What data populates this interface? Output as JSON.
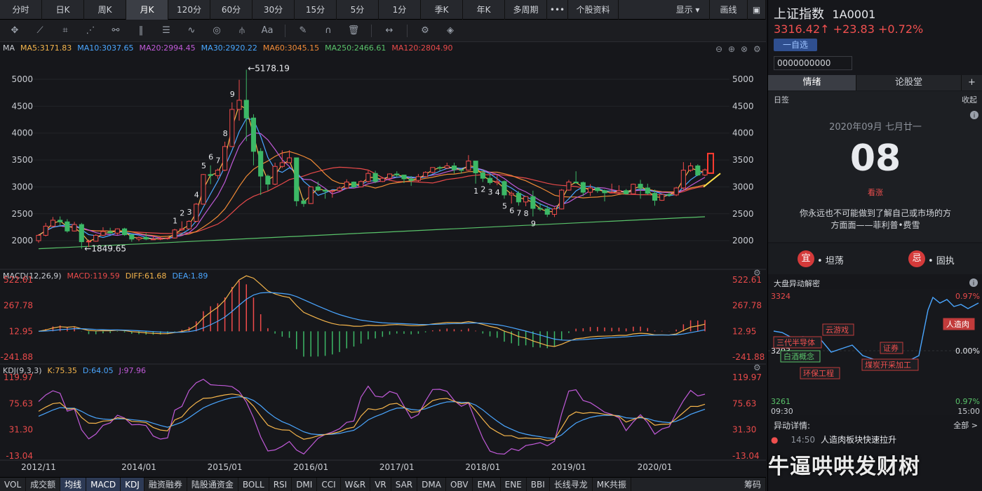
{
  "topbar": {
    "periods": [
      {
        "label": "分时",
        "active": false,
        "w": 60
      },
      {
        "label": "日K",
        "active": false,
        "w": 60
      },
      {
        "label": "周K",
        "active": false,
        "w": 60
      },
      {
        "label": "月K",
        "active": true,
        "w": 60
      },
      {
        "label": "120分",
        "active": false,
        "w": 60
      },
      {
        "label": "60分",
        "active": false,
        "w": 60
      },
      {
        "label": "30分",
        "active": false,
        "w": 60
      },
      {
        "label": "15分",
        "active": false,
        "w": 60
      },
      {
        "label": "5分",
        "active": false,
        "w": 60
      },
      {
        "label": "1分",
        "active": false,
        "w": 60
      },
      {
        "label": "季K",
        "active": false,
        "w": 60
      },
      {
        "label": "年K",
        "active": false,
        "w": 60
      },
      {
        "label": "多周期",
        "active": false,
        "w": 60
      },
      {
        "label": "•••",
        "active": false,
        "w": 30
      },
      {
        "label": "个股资料",
        "active": false,
        "w": 72
      }
    ],
    "display_label": "显示",
    "draw_label": "画线"
  },
  "ma_line": [
    {
      "text": "MA",
      "color": "#c9ccd2"
    },
    {
      "text": "MA5:3171.83",
      "color": "#f5b54b"
    },
    {
      "text": "MA10:3037.65",
      "color": "#4aa6ff"
    },
    {
      "text": "MA20:2994.45",
      "color": "#c05ad8"
    },
    {
      "text": "MA30:2920.22",
      "color": "#48a7ff"
    },
    {
      "text": "MA60:3045.15",
      "color": "#f08a36"
    },
    {
      "text": "MA250:2466.61",
      "color": "#59c36a"
    },
    {
      "text": "MA120:2804.90",
      "color": "#e94a4a"
    }
  ],
  "macd_line": [
    {
      "text": "MACD(12,26,9)",
      "color": "#c9ccd2"
    },
    {
      "text": "MACD:119.59",
      "color": "#e94a4a"
    },
    {
      "text": "DIFF:61.68",
      "color": "#f5b54b"
    },
    {
      "text": "DEA:1.89",
      "color": "#4aa6ff"
    }
  ],
  "kdj_line": [
    {
      "text": "KDJ(9,3,3)",
      "color": "#c9ccd2"
    },
    {
      "text": "K:75.35",
      "color": "#f5b54b"
    },
    {
      "text": "D:64.05",
      "color": "#4aa6ff"
    },
    {
      "text": "J:97.96",
      "color": "#c05ad8"
    }
  ],
  "chart_data": {
    "type": "candlestick",
    "price_ticks": [
      "5000",
      "4500",
      "4000",
      "3500",
      "3000",
      "2500",
      "2000"
    ],
    "macd_ticks": [
      "522.61",
      "267.78",
      "12.95",
      "-241.88"
    ],
    "kdj_ticks": [
      "119.97",
      "75.63",
      "31.30",
      "-13.04"
    ],
    "x_ticks": [
      "2012/11",
      "2014/01",
      "2015/01",
      "2016/01",
      "2017/01",
      "2018/01",
      "2019/01",
      "2020/01"
    ],
    "annotations": {
      "high": "←5178.19",
      "low": "←1849.65"
    },
    "td_up_labels": [
      "1",
      "2",
      "3",
      "4",
      "5",
      "6",
      "7",
      "8",
      "9"
    ],
    "td_down_labels": [
      "1",
      "2",
      "3",
      "4",
      "5",
      "6",
      "7",
      "8",
      "9"
    ],
    "monthly": [
      {
        "o": 2000,
        "h": 2120,
        "l": 1960,
        "c": 2100
      },
      {
        "o": 2100,
        "h": 2330,
        "l": 2080,
        "c": 2270
      },
      {
        "o": 2270,
        "h": 2440,
        "l": 2250,
        "c": 2380
      },
      {
        "o": 2380,
        "h": 2450,
        "l": 2280,
        "c": 2350
      },
      {
        "o": 2350,
        "h": 2400,
        "l": 2150,
        "c": 2180
      },
      {
        "o": 2180,
        "h": 2350,
        "l": 2170,
        "c": 2300
      },
      {
        "o": 2300,
        "h": 2330,
        "l": 1850,
        "c": 1980
      },
      {
        "o": 1980,
        "h": 2020,
        "l": 1880,
        "c": 1990
      },
      {
        "o": 1990,
        "h": 2120,
        "l": 1980,
        "c": 2100
      },
      {
        "o": 2100,
        "h": 2250,
        "l": 2090,
        "c": 2170
      },
      {
        "o": 2170,
        "h": 2240,
        "l": 2130,
        "c": 2140
      },
      {
        "o": 2140,
        "h": 2230,
        "l": 2110,
        "c": 2220
      },
      {
        "o": 2220,
        "h": 2240,
        "l": 2090,
        "c": 2110
      },
      {
        "o": 2110,
        "h": 2120,
        "l": 1980,
        "c": 2030
      },
      {
        "o": 2030,
        "h": 2080,
        "l": 1990,
        "c": 2060
      },
      {
        "o": 2060,
        "h": 2140,
        "l": 2010,
        "c": 2030
      },
      {
        "o": 2030,
        "h": 2100,
        "l": 2020,
        "c": 2030
      },
      {
        "o": 2030,
        "h": 2080,
        "l": 2010,
        "c": 2040
      },
      {
        "o": 2040,
        "h": 2060,
        "l": 2020,
        "c": 2050
      },
      {
        "o": 2050,
        "h": 2220,
        "l": 2040,
        "c": 2200
      },
      {
        "o": 2200,
        "h": 2360,
        "l": 2180,
        "c": 2220
      },
      {
        "o": 2220,
        "h": 2380,
        "l": 2210,
        "c": 2360
      },
      {
        "o": 2360,
        "h": 2700,
        "l": 2340,
        "c": 2680
      },
      {
        "o": 2680,
        "h": 3240,
        "l": 2670,
        "c": 3230
      },
      {
        "o": 3230,
        "h": 3400,
        "l": 3050,
        "c": 3210
      },
      {
        "o": 3210,
        "h": 3340,
        "l": 3150,
        "c": 3310
      },
      {
        "o": 3310,
        "h": 3840,
        "l": 3290,
        "c": 3750
      },
      {
        "o": 3750,
        "h": 4570,
        "l": 3740,
        "c": 4440
      },
      {
        "o": 4440,
        "h": 4990,
        "l": 4230,
        "c": 4610
      },
      {
        "o": 4610,
        "h": 5178,
        "l": 3850,
        "c": 4280
      },
      {
        "o": 4280,
        "h": 4350,
        "l": 3400,
        "c": 3660
      },
      {
        "o": 3660,
        "h": 3720,
        "l": 2850,
        "c": 3200
      },
      {
        "o": 3200,
        "h": 3230,
        "l": 2930,
        "c": 3050
      },
      {
        "o": 3050,
        "h": 3450,
        "l": 3030,
        "c": 3380
      },
      {
        "o": 3380,
        "h": 3680,
        "l": 3350,
        "c": 3450
      },
      {
        "o": 3450,
        "h": 3680,
        "l": 3450,
        "c": 3540
      },
      {
        "o": 3540,
        "h": 3540,
        "l": 2640,
        "c": 2740
      },
      {
        "o": 2740,
        "h": 2790,
        "l": 2630,
        "c": 2690
      },
      {
        "o": 2690,
        "h": 3010,
        "l": 2680,
        "c": 3000
      },
      {
        "o": 3000,
        "h": 3100,
        "l": 2920,
        "c": 2940
      },
      {
        "o": 2940,
        "h": 2960,
        "l": 2780,
        "c": 2920
      },
      {
        "o": 2920,
        "h": 2950,
        "l": 2800,
        "c": 2930
      },
      {
        "o": 2930,
        "h": 3010,
        "l": 2920,
        "c": 2980
      },
      {
        "o": 2980,
        "h": 3140,
        "l": 2960,
        "c": 3090
      },
      {
        "o": 3090,
        "h": 3100,
        "l": 2980,
        "c": 3000
      },
      {
        "o": 3000,
        "h": 3120,
        "l": 2990,
        "c": 3100
      },
      {
        "o": 3100,
        "h": 3300,
        "l": 3080,
        "c": 3250
      },
      {
        "o": 3250,
        "h": 3300,
        "l": 3070,
        "c": 3100
      },
      {
        "o": 3100,
        "h": 3180,
        "l": 3090,
        "c": 3160
      },
      {
        "o": 3160,
        "h": 3250,
        "l": 3150,
        "c": 3240
      },
      {
        "o": 3240,
        "h": 3290,
        "l": 3180,
        "c": 3220
      },
      {
        "o": 3220,
        "h": 3220,
        "l": 3070,
        "c": 3150
      },
      {
        "o": 3150,
        "h": 3200,
        "l": 3020,
        "c": 3120
      },
      {
        "o": 3120,
        "h": 3240,
        "l": 3090,
        "c": 3190
      },
      {
        "o": 3190,
        "h": 3290,
        "l": 3180,
        "c": 3270
      },
      {
        "o": 3270,
        "h": 3360,
        "l": 3250,
        "c": 3360
      },
      {
        "o": 3360,
        "h": 3390,
        "l": 3300,
        "c": 3350
      },
      {
        "o": 3350,
        "h": 3450,
        "l": 3330,
        "c": 3390
      },
      {
        "o": 3390,
        "h": 3450,
        "l": 3250,
        "c": 3320
      },
      {
        "o": 3320,
        "h": 3320,
        "l": 3250,
        "c": 3310
      },
      {
        "o": 3310,
        "h": 3590,
        "l": 3300,
        "c": 3480
      },
      {
        "o": 3480,
        "h": 3480,
        "l": 3060,
        "c": 3260
      },
      {
        "o": 3260,
        "h": 3330,
        "l": 3090,
        "c": 3160
      },
      {
        "o": 3160,
        "h": 3220,
        "l": 3040,
        "c": 3080
      },
      {
        "o": 3080,
        "h": 3220,
        "l": 3030,
        "c": 3100
      },
      {
        "o": 3100,
        "h": 3120,
        "l": 2780,
        "c": 2850
      },
      {
        "o": 2850,
        "h": 2920,
        "l": 2690,
        "c": 2880
      },
      {
        "o": 2880,
        "h": 2920,
        "l": 2650,
        "c": 2720
      },
      {
        "o": 2720,
        "h": 2830,
        "l": 2640,
        "c": 2820
      },
      {
        "o": 2820,
        "h": 2930,
        "l": 2450,
        "c": 2600
      },
      {
        "o": 2600,
        "h": 2700,
        "l": 2550,
        "c": 2590
      },
      {
        "o": 2590,
        "h": 2650,
        "l": 2440,
        "c": 2490
      },
      {
        "o": 2490,
        "h": 2620,
        "l": 2440,
        "c": 2590
      },
      {
        "o": 2590,
        "h": 2960,
        "l": 2580,
        "c": 2940
      },
      {
        "o": 2940,
        "h": 3130,
        "l": 2930,
        "c": 3090
      },
      {
        "o": 3090,
        "h": 3290,
        "l": 3060,
        "c": 3080
      },
      {
        "o": 3080,
        "h": 3100,
        "l": 2830,
        "c": 2900
      },
      {
        "o": 2900,
        "h": 3050,
        "l": 2830,
        "c": 2980
      },
      {
        "o": 2980,
        "h": 2990,
        "l": 2890,
        "c": 2930
      },
      {
        "o": 2930,
        "h": 2950,
        "l": 2730,
        "c": 2890
      },
      {
        "o": 2890,
        "h": 3060,
        "l": 2880,
        "c": 2900
      },
      {
        "o": 2900,
        "h": 3030,
        "l": 2880,
        "c": 2930
      },
      {
        "o": 2930,
        "h": 2960,
        "l": 2860,
        "c": 2870
      },
      {
        "o": 2870,
        "h": 3060,
        "l": 2860,
        "c": 3050
      },
      {
        "o": 3050,
        "h": 3130,
        "l": 2780,
        "c": 2980
      },
      {
        "o": 2980,
        "h": 3060,
        "l": 2850,
        "c": 2880
      },
      {
        "o": 2880,
        "h": 2950,
        "l": 2650,
        "c": 2750
      },
      {
        "o": 2750,
        "h": 2860,
        "l": 2740,
        "c": 2860
      },
      {
        "o": 2860,
        "h": 2900,
        "l": 2820,
        "c": 2850
      },
      {
        "o": 2850,
        "h": 3000,
        "l": 2830,
        "c": 2980
      },
      {
        "o": 2980,
        "h": 3460,
        "l": 2950,
        "c": 3310
      },
      {
        "o": 3310,
        "h": 3450,
        "l": 3280,
        "c": 3390
      },
      {
        "o": 3390,
        "h": 3420,
        "l": 3200,
        "c": 3220
      },
      {
        "o": 3220,
        "h": 3340,
        "l": 3200,
        "c": 3316
      }
    ],
    "ylim_price": [
      1780,
      5300
    ]
  },
  "right": {
    "name": "上证指数",
    "code": "1A0001",
    "price": "3316.42",
    "arrow": "↑",
    "change": "+23.83",
    "pct": "+0.72%",
    "add_watch": "一自选",
    "input_value": "0000000000",
    "tab_qingxu": "情绪",
    "tab_lungutang": "论股堂",
    "tab_add": "+",
    "rixian": "日签",
    "shouqi": "收起",
    "date": "2020年09月 七月廿一",
    "day": "08",
    "mood": "看涨",
    "quote": "你永远也不可能做到了解自己或市场的方方面面——菲利普•费雪",
    "yi": "宜",
    "yi_text": "• 坦荡",
    "ji": "忌",
    "ji_text": "• 固执",
    "dapan_title": "大盘异动解密",
    "mini_high": "3324",
    "mini_mid": "3293",
    "mini_low": "3261",
    "mini_pct_high": "0.97%",
    "mini_pct_mid": "0.00%",
    "mini_pct_low": "0.97%",
    "mini_t_start": "09:30",
    "mini_t_end": "15:00",
    "tags": [
      "云游戏",
      "三代半导体",
      "白酒概念",
      "环保工程",
      "证券",
      "煤炭开采加工",
      "人造肉"
    ],
    "yidong_label": "异动详情:",
    "quanbu": "全部 >",
    "event_time": "14:50",
    "event_text": "人造肉板块快速拉升"
  },
  "bottombar": [
    "VOL",
    "成交额",
    "均线",
    "MACD",
    "KDJ",
    "融资融券",
    "陆股通资金",
    "BOLL",
    "RSI",
    "DMI",
    "CCI",
    "W&R",
    "VR",
    "SAR",
    "DMA",
    "OBV",
    "EMA",
    "ENE",
    "BBI",
    "长线寻龙",
    "MK共振",
    "筹码"
  ],
  "watermark": "牛逼哄哄发财树",
  "colors": {
    "up": "#f04b4b",
    "down": "#3cb866",
    "ma5": "#f5b54b",
    "ma10": "#4aa6ff",
    "ma20": "#c05ad8",
    "ma60": "#f08a36",
    "ma120": "#e94a4a",
    "ma250": "#59c36a"
  }
}
